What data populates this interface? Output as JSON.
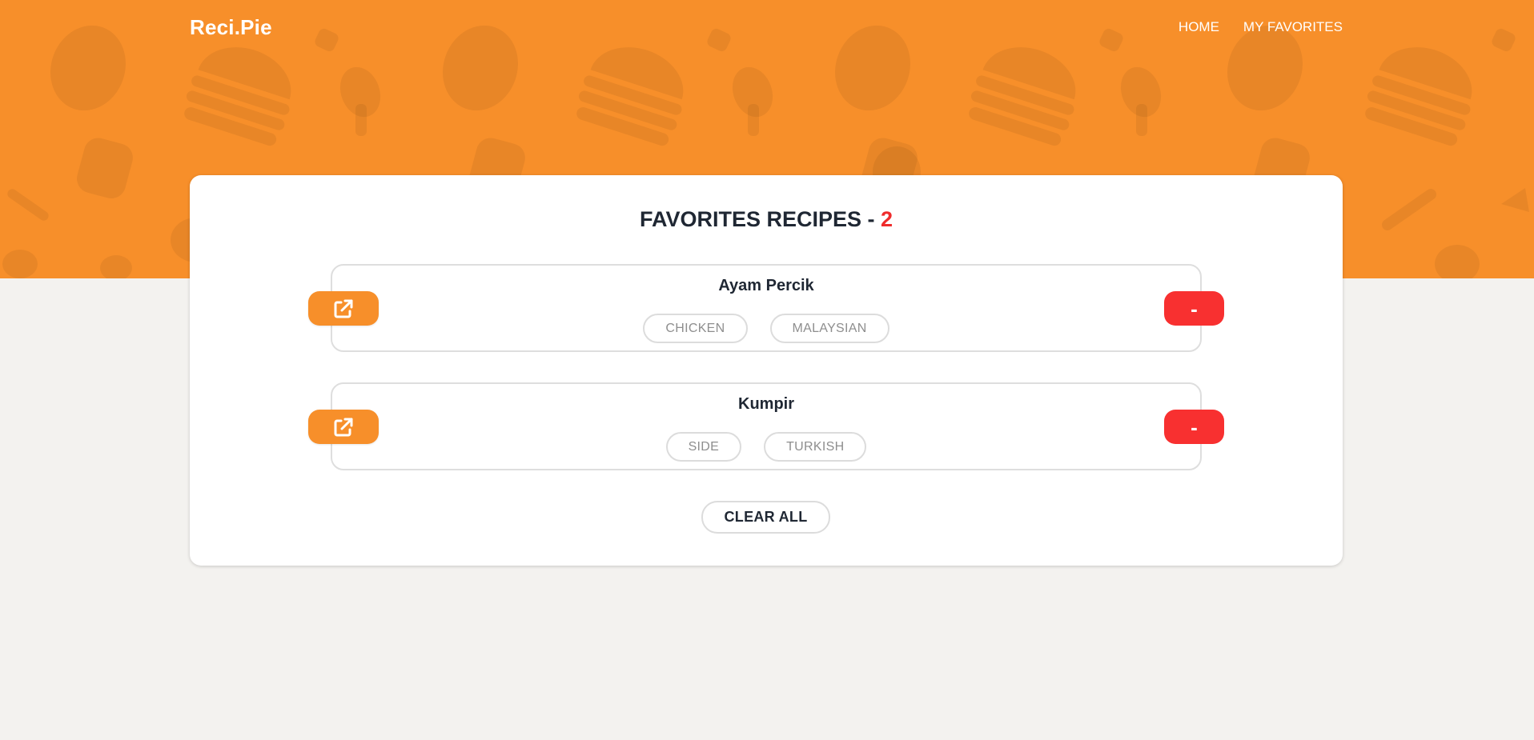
{
  "brand": {
    "name": "Reci.Pie"
  },
  "nav": [
    {
      "label": "HOME"
    },
    {
      "label": "MY FAVORITES"
    }
  ],
  "favorites": {
    "title": "FAVORITES RECIPES - ",
    "count": "2",
    "recipes": [
      {
        "name": "Ayam Percik",
        "tags": [
          "CHICKEN",
          "MALAYSIAN"
        ],
        "open_icon": "external-link-icon",
        "remove_label": "-"
      },
      {
        "name": "Kumpir",
        "tags": [
          "SIDE",
          "TURKISH"
        ],
        "open_icon": "external-link-icon",
        "remove_label": "-"
      }
    ],
    "clear_label": "CLEAR ALL"
  },
  "colors": {
    "accent": "#f78f2a",
    "danger": "#f83030",
    "background": "#f3f2ef",
    "text": "#1f2733"
  }
}
